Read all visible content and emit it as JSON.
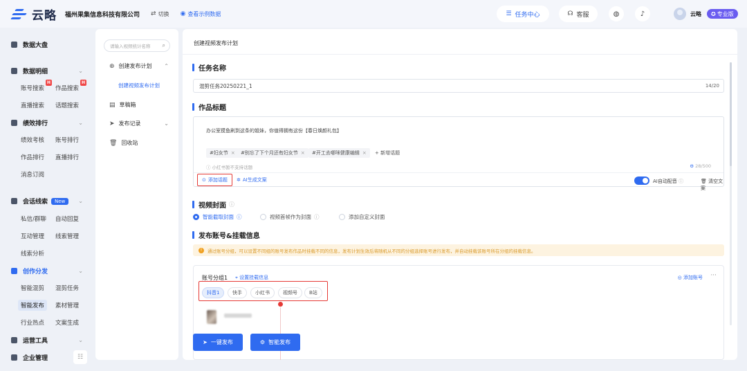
{
  "brand": {
    "name": "云略",
    "company": "福州果集信息科技有限公司",
    "switch": "切换",
    "demo": "查看示例数据",
    "accent": "#2f6bf0"
  },
  "topbar": {
    "task_center": "任务中心",
    "service": "客服",
    "user": "云略",
    "plan": "专业版"
  },
  "sidebar": {
    "s1": "数据大盘",
    "s2": "数据明细",
    "s2_items": [
      "账号搜索",
      "作品搜索",
      "直播搜索",
      "话题搜索"
    ],
    "s3": "绩效排行",
    "s3_items": [
      "绩效考核",
      "账号排行",
      "作品排行",
      "直播排行",
      "消息订阅"
    ],
    "s4": "会话线索",
    "s4_badge": "New",
    "s4_items": [
      "私信/群聊",
      "自动回复",
      "互动管理",
      "线索管理",
      "线索分析"
    ],
    "s5": "创作分发",
    "s5_items": [
      "智能混剪",
      "混剪任务",
      "智能发布",
      "素材管理",
      "行业热点",
      "文案生成"
    ],
    "s6": "运营工具",
    "s7": "企业管理",
    "hot_badge": "H"
  },
  "subnav": {
    "search_placeholder": "请输入视频统计名称",
    "create": "创建发布计划",
    "create_video": "创建视频发布计划",
    "drafts": "草稿箱",
    "records": "发布记录",
    "trash": "回收站"
  },
  "main": {
    "page_title": "创建视频发布计划",
    "task_name_label": "任务名称",
    "task_name_value": "混剪任务20250221_1",
    "task_name_count": "14/20",
    "work_title_label": "作品标题",
    "body_text": "办公室摸鱼刷到这条的姐妹，你值得拥有这份【春日焕颜礼包】",
    "tags": [
      "#妇女节",
      "#别忘了下个月还有妇女节",
      "#开工去哪咪健康编辑"
    ],
    "add_topic_inline": "+ 新增话题",
    "hint": "小红书暂不支持话题",
    "char_count": "28/500",
    "add_topic_btn": "添加话题",
    "ai_gen": "AI生成文案",
    "ai_auto": "AI自动配音",
    "clear": "清空文案",
    "cover_label": "视频封面",
    "cover_options": [
      "智能截取封面",
      "视频首帧作为封面",
      "添加自定义封面"
    ],
    "publish_label": "发布账号&挂载信息",
    "notice": "通过账号分组，可以设置不同组的账号发布作品时挂载不同的信息，发布计划生效后将随机从不同的分组选择账号进行发布，并自动挂载该账号所在分组的挂载信息。",
    "group_name": "账号分组1",
    "mount_set": "设置挂载信息",
    "add_account": "添加账号",
    "more": "···",
    "platforms": [
      "抖音1",
      "快手",
      "小红书",
      "视频号",
      "B站"
    ],
    "btn_one_click": "一键发布",
    "btn_smart": "智能发布"
  }
}
